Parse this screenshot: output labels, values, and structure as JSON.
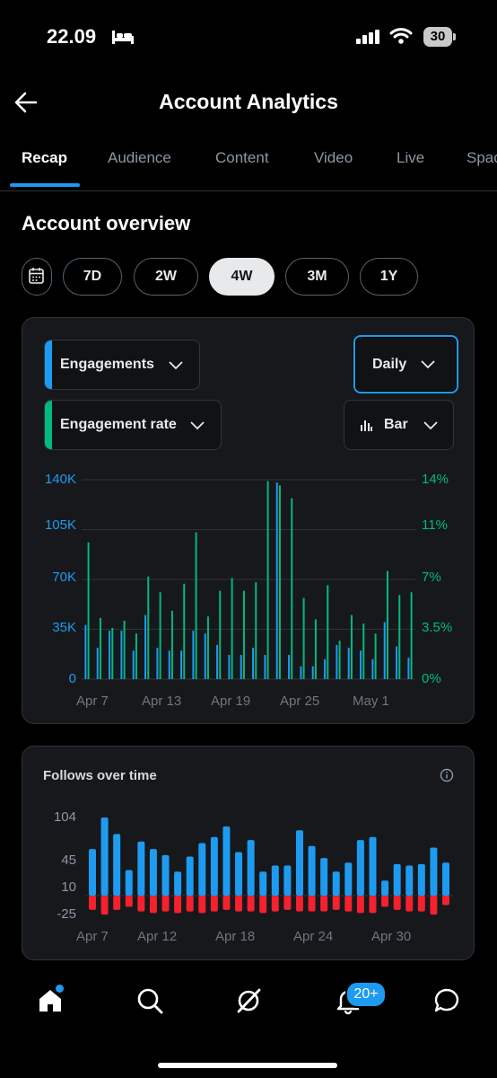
{
  "status_bar": {
    "time": "22.09",
    "battery": "30"
  },
  "header": {
    "title": "Account Analytics"
  },
  "tabs": [
    {
      "label": "Recap",
      "active": true
    },
    {
      "label": "Audience"
    },
    {
      "label": "Content"
    },
    {
      "label": "Video"
    },
    {
      "label": "Live"
    },
    {
      "label": "Spac"
    }
  ],
  "overview": {
    "title": "Account overview",
    "ranges": [
      "7D",
      "2W",
      "4W",
      "3M",
      "1Y"
    ],
    "selected_range": "4W"
  },
  "engagement_card": {
    "metric1": "Engagements",
    "metric2": "Engagement rate",
    "interval": "Daily",
    "chart_type": "Bar",
    "colors": {
      "metric1": "#1d9bf0",
      "metric2": "#00ba7c"
    }
  },
  "follows_card": {
    "title": "Follows over time",
    "colors": {
      "follows": "#1d9bf0",
      "unfollows": "#f4212e"
    }
  },
  "chart_data": [
    {
      "type": "bar",
      "title": "",
      "y_left_ticks": [
        "140K",
        "105K",
        "70K",
        "35K",
        "0"
      ],
      "y_right_ticks": [
        "14%",
        "11%",
        "7%",
        "3.5%",
        "0%"
      ],
      "x_tick_labels": [
        "Apr 7",
        "Apr 13",
        "Apr 19",
        "Apr 25",
        "May 1"
      ],
      "ylim_left": [
        0,
        140000
      ],
      "ylim_right": [
        0,
        14
      ],
      "series": [
        {
          "name": "Engagements",
          "axis": "left",
          "values": [
            38000,
            22000,
            34000,
            34000,
            20000,
            45000,
            22000,
            20000,
            20000,
            34000,
            32000,
            24000,
            17000,
            17000,
            22000,
            17000,
            138000,
            17000,
            9000,
            9000,
            14000,
            24000,
            22000,
            20000,
            14000,
            40000,
            23000,
            15000
          ]
        },
        {
          "name": "Engagement rate",
          "axis": "right",
          "values": [
            9.6,
            4.3,
            3.6,
            4.1,
            3.2,
            7.2,
            6.1,
            4.8,
            6.7,
            10.3,
            4.4,
            6.2,
            7.1,
            6.2,
            6.8,
            13.9,
            13.6,
            12.7,
            5.7,
            4.2,
            6.6,
            2.7,
            4.5,
            3.9,
            3.2,
            7.6,
            5.9,
            6.1
          ]
        }
      ],
      "grid": true,
      "legend": "none"
    },
    {
      "type": "bar",
      "title": "Follows over time",
      "y_ticks": [
        "104",
        "45",
        "10",
        "-25"
      ],
      "x_tick_labels": [
        "Apr 7",
        "Apr 12",
        "Apr 18",
        "Apr 24",
        "Apr 30"
      ],
      "ylim": [
        -25,
        104
      ],
      "series": [
        {
          "name": "Follows",
          "values": [
            62,
            104,
            82,
            34,
            72,
            62,
            54,
            32,
            52,
            70,
            78,
            92,
            58,
            74,
            32,
            40,
            40,
            87,
            66,
            50,
            32,
            44,
            74,
            78,
            20,
            42,
            40,
            42,
            64,
            44
          ]
        },
        {
          "name": "Unfollows",
          "values": [
            -18,
            -24,
            -18,
            -14,
            -20,
            -22,
            -20,
            -22,
            -20,
            -22,
            -20,
            -18,
            -20,
            -20,
            -22,
            -20,
            -18,
            -20,
            -20,
            -20,
            -18,
            -20,
            -22,
            -22,
            -14,
            -18,
            -20,
            -20,
            -24,
            -12
          ]
        }
      ],
      "grid": true,
      "legend": "none"
    }
  ]
}
